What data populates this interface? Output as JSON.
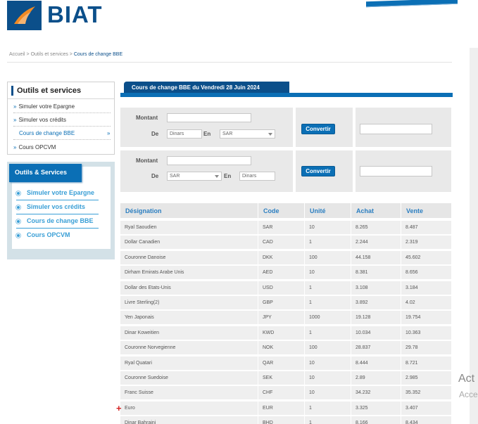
{
  "header": {
    "brand": "BIAT",
    "logo_icon": "biat-flame-logo",
    "brand_color": "#0b4f8a"
  },
  "breadcrumb": {
    "items": [
      "Accueil",
      "Outils et services",
      "Cours de change BBE"
    ]
  },
  "outils": {
    "title": "Outils et services",
    "items": [
      {
        "label": "Simuler votre Epargne"
      },
      {
        "label": "Simuler vos crédits"
      },
      {
        "label": "Cours de change BBE"
      },
      {
        "label": "Cours OPCVM"
      }
    ]
  },
  "services": {
    "title": "Outils & Services",
    "items": [
      {
        "label": "Simuler votre Epargne"
      },
      {
        "label": "Simuler vos crédits"
      },
      {
        "label": "Cours de change BBE"
      },
      {
        "label": "Cours OPCVM"
      }
    ],
    "accent": "#3a9fd6"
  },
  "main": {
    "title": "Cours de change BBE du Vendredi 28 Juin 2024"
  },
  "converter1": {
    "montant_label": "Montant",
    "montant_value": "",
    "de_label": "De",
    "en_label": "En",
    "from_value": "Dinars",
    "to_value": "SAR",
    "button": "Convertir",
    "result": ""
  },
  "converter2": {
    "montant_label": "Montant",
    "montant_value": "",
    "de_label": "De",
    "en_label": "En",
    "from_value": "SAR",
    "to_value": "Dinars",
    "button": "Convertir",
    "result": ""
  },
  "table": {
    "headers": [
      "Désignation",
      "Code",
      "Unité",
      "Achat",
      "Vente"
    ],
    "rows": [
      [
        "Ryal Saoudien",
        "SAR",
        "10",
        "8.265",
        "8.487"
      ],
      [
        "Dollar Canadien",
        "CAD",
        "1",
        "2.244",
        "2.319"
      ],
      [
        "Couronne Danoise",
        "DKK",
        "100",
        "44.158",
        "45.602"
      ],
      [
        "Dirham Emirats Arabe Unis",
        "AED",
        "10",
        "8.381",
        "8.656"
      ],
      [
        "Dollar des Etats-Unis",
        "USD",
        "1",
        "3.108",
        "3.184"
      ],
      [
        "Livre Sterling(2)",
        "GBP",
        "1",
        "3.892",
        "4.02"
      ],
      [
        "Yen Japonais",
        "JPY",
        "1000",
        "19.128",
        "19.754"
      ],
      [
        "Dinar Koweitien",
        "KWD",
        "1",
        "10.034",
        "10.363"
      ],
      [
        "Couronne Norvegienne",
        "NOK",
        "100",
        "28.837",
        "29.78"
      ],
      [
        "Ryal Quatari",
        "QAR",
        "10",
        "8.444",
        "8.721"
      ],
      [
        "Couronne Suedoise",
        "SEK",
        "10",
        "2.89",
        "2.985"
      ],
      [
        "Franc Suisse",
        "CHF",
        "10",
        "34.232",
        "35.352"
      ],
      [
        "Euro",
        "EUR",
        "1",
        "3.325",
        "3.407"
      ],
      [
        "Dinar Bahraini",
        "BHD",
        "1",
        "8.166",
        "8.434"
      ]
    ]
  },
  "watermark": {
    "line1": "Act",
    "line2": "Acce"
  }
}
